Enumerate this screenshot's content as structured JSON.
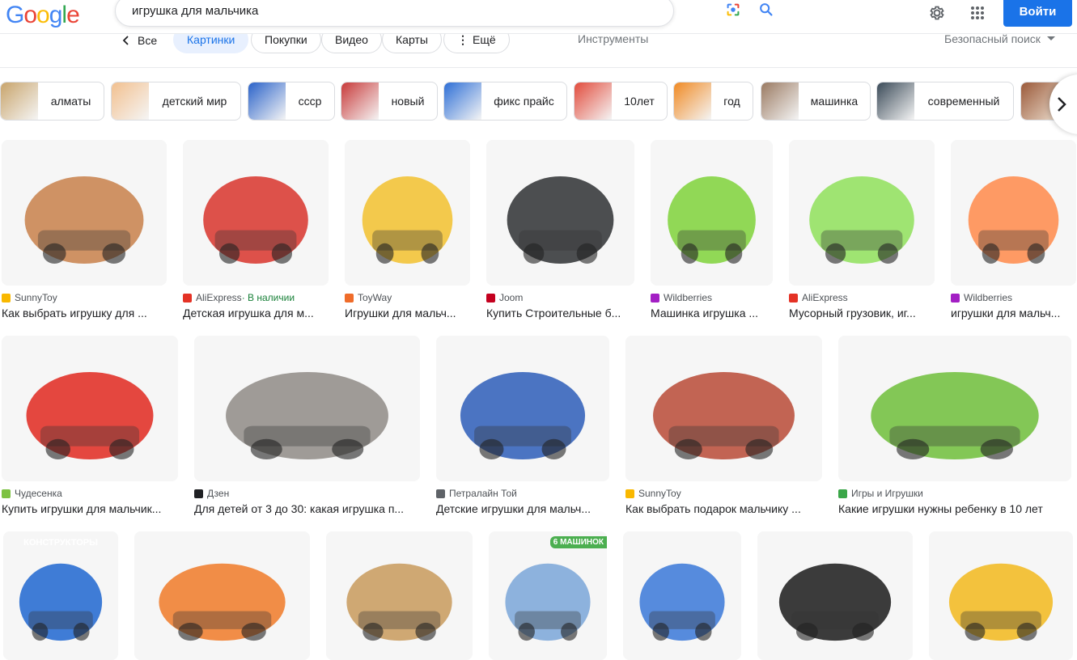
{
  "header": {
    "logo": "Google",
    "search_value": "игрушка для мальчика",
    "signin_label": "Войти",
    "icons": [
      "google-lens-icon",
      "search-icon",
      "settings-icon",
      "apps-grid-icon"
    ]
  },
  "tabs": {
    "back_label": "Все",
    "items": [
      "Картинки",
      "Покупки",
      "Видео",
      "Карты",
      "Ещё"
    ],
    "more_glyph": "⋮",
    "active": "Картинки",
    "tools_label": "Инструменты",
    "safesearch_label": "Безопасный поиск"
  },
  "chips": [
    {
      "label": "алматы",
      "color": "#c8a46b"
    },
    {
      "label": "детский мир",
      "color": "#f2c08f"
    },
    {
      "label": "ссср",
      "color": "#2a62c9"
    },
    {
      "label": "новый",
      "color": "#c83a3a"
    },
    {
      "label": "фикс прайс",
      "color": "#2e6fd6"
    },
    {
      "label": "10лет",
      "color": "#e24b3c"
    },
    {
      "label": "год",
      "color": "#f08a24"
    },
    {
      "label": "машинка",
      "color": "#9a7a62"
    },
    {
      "label": "современный",
      "color": "#3a4a58"
    }
  ],
  "results": [
    {
      "source": "SunnyToy",
      "title": "Как выбрать игрушку для ...",
      "fav": "#f9b800",
      "img": "#c8804a"
    },
    {
      "source": "AliExpress",
      "availability": " · В наличии",
      "title": "Детская игрушка для м...",
      "fav": "#e43225",
      "img": "#d8342c"
    },
    {
      "source": "ToyWay",
      "title": "Игрушки для мальч...",
      "fav": "#ef6c2a",
      "img": "#f2c12e"
    },
    {
      "source": "Joom",
      "title": "Купить Строительные б...",
      "fav": "#c4001f",
      "img": "#2e3033"
    },
    {
      "source": "Wildberries",
      "title": "Машинка игрушка ...",
      "fav": "#a31fc4",
      "img": "#7fd23a"
    },
    {
      "source": "AliExpress",
      "title": "Мусорный грузовик, иг...",
      "fav": "#e43225",
      "img": "#8fe05b"
    },
    {
      "source": "Wildberries",
      "title": "игрушки для мальч...",
      "fav": "#a31fc4",
      "img": "#ff8a4a"
    },
    {
      "source": "Чудесенка",
      "title": "Купить игрушки для мальчик...",
      "fav": "#7dc242",
      "img": "#e0281e"
    },
    {
      "source": "Дзен",
      "title": "Для детей от 3 до 30: какая игрушка п...",
      "fav": "#202124",
      "img": "#8f8b86"
    },
    {
      "source": "Петралайн Той",
      "title": "Детские игрушки для мальч...",
      "fav": "#5f6368",
      "img": "#2d5db8"
    },
    {
      "source": "SunnyToy",
      "title": "Как выбрать подарок мальчику ...",
      "fav": "#f9b800",
      "img": "#b84a36"
    },
    {
      "source": "Игры и Игрушки",
      "title": "Какие игрушки нужны ребенку в 10 лет",
      "fav": "#3aa648",
      "img": "#6fbe3a"
    },
    {
      "overlay": "КОНСТРУКТОРЫ",
      "img": "#1e66d0"
    },
    {
      "img": "#f07a28"
    },
    {
      "img": "#c89a5c"
    },
    {
      "badge": "6 МАШИНОК",
      "img": "#7aa6d8"
    },
    {
      "img": "#3a78d8"
    },
    {
      "img": "#1a1a1a"
    },
    {
      "img": "#f2b81c"
    }
  ]
}
